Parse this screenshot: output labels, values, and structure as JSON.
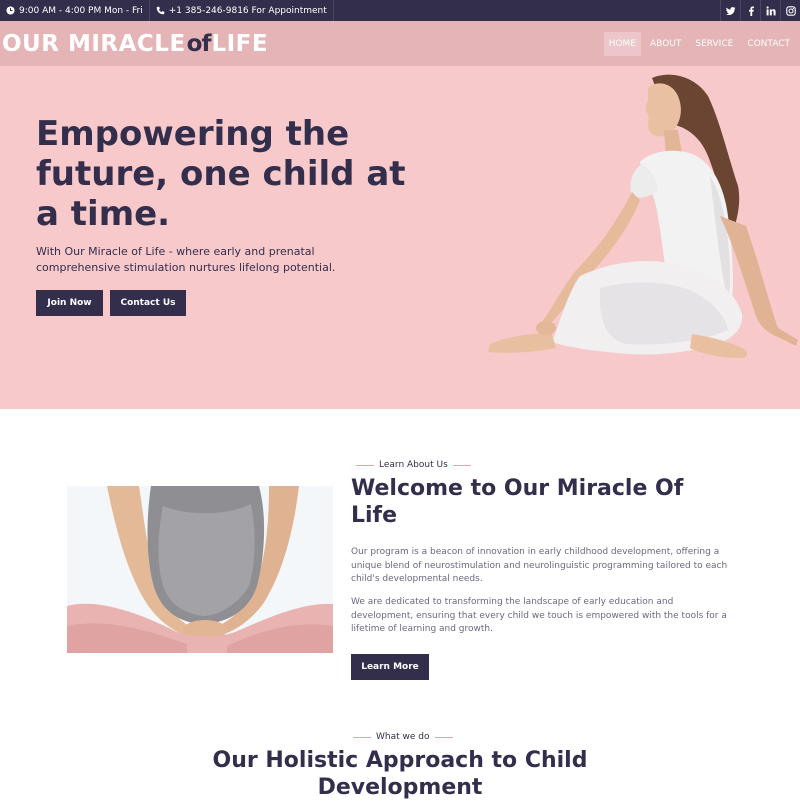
{
  "topbar": {
    "hours": "9:00 AM - 4:00 PM Mon - Fri",
    "phone": "+1 385-246-9816 For Appointment",
    "social": [
      "twitter-icon",
      "facebook-icon",
      "linkedin-icon",
      "instagram-icon"
    ]
  },
  "header": {
    "logo_part1": "OUR MIRACLE",
    "logo_part2": "of",
    "logo_part3": "LIFE",
    "nav": [
      "HOME",
      "ABOUT",
      "SERVICE",
      "CONTACT"
    ],
    "active_nav": "HOME"
  },
  "hero": {
    "title": "Empowering the future, one child at a time.",
    "subtitle": "With Our Miracle of Life - where early and prenatal comprehensive stimulation nurtures lifelong potential.",
    "join_label": "Join Now",
    "contact_label": "Contact Us"
  },
  "about": {
    "kicker": "Learn About Us",
    "title": "Welcome to Our Miracle Of Life",
    "p1": "Our program is a beacon of innovation in early childhood development, offering a unique blend of neurostimulation and neurolinguistic programming tailored to each child's developmental needs.",
    "p2": "We are dedicated to transforming the landscape of early education and development, ensuring that every child we touch is empowered with the tools for a lifetime of learning and growth.",
    "button_label": "Learn More"
  },
  "approach": {
    "kicker": "What we do",
    "title": "Our Holistic Approach to Child Development"
  },
  "colors": {
    "dark": "#332e4c",
    "hero_bg": "#f7c9ca",
    "header_bg": "#e4b4b6",
    "accent_line": "#e4a5a7"
  }
}
